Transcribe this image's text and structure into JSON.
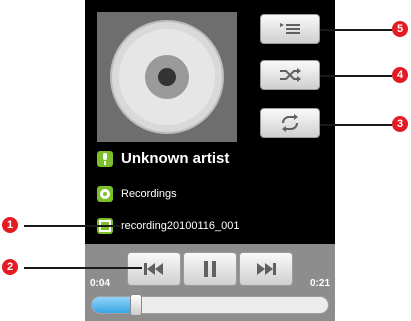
{
  "track_info": {
    "artist": "Unknown artist",
    "album": "Recordings",
    "track": "recording20100116_001"
  },
  "playback": {
    "elapsed": "0:04",
    "duration": "0:21",
    "progress_fraction": 0.19
  },
  "side_buttons": [
    "playlist-icon",
    "shuffle-icon",
    "repeat-icon"
  ],
  "transport": [
    "previous-icon",
    "pause-icon",
    "next-icon"
  ],
  "callouts": {
    "c1": "1",
    "c2": "2",
    "c3": "3",
    "c4": "4",
    "c5": "5"
  },
  "colors": {
    "callout": "#e31b23",
    "progress": "#3aa6e6",
    "icon_accent": "#7cbf2a"
  }
}
